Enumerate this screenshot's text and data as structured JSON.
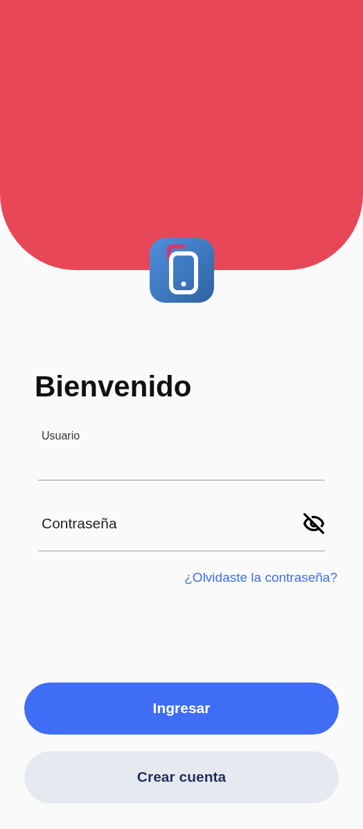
{
  "title": "Bienvenido",
  "fields": [
    {
      "kind": "label",
      "label": "Usuario"
    },
    {
      "kind": "password",
      "placeholder": "Contraseña",
      "password_visible": false
    }
  ],
  "forgot_link": "¿Olvidaste la contraseña?",
  "buttons": [
    {
      "kind": "primary",
      "label": "Ingresar"
    },
    {
      "kind": "secondary",
      "label": "Crear cuenta"
    }
  ]
}
